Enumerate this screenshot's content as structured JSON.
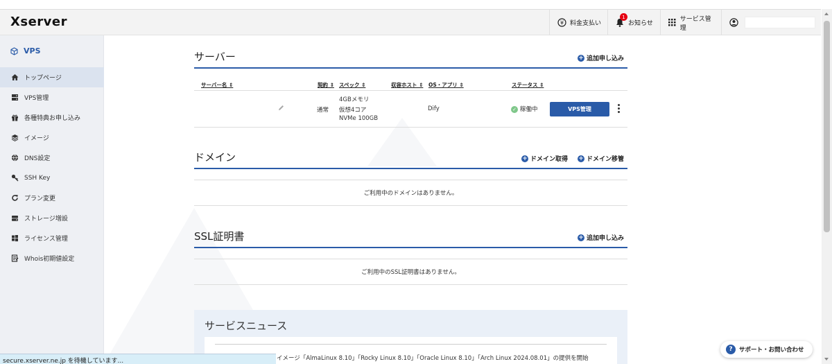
{
  "header": {
    "logo": "Xserver",
    "payment": "料金支払い",
    "notifications": "お知らせ",
    "notification_count": "1",
    "services": "サービス管理",
    "account_value": ""
  },
  "sidebar": {
    "title": "VPS",
    "items": [
      {
        "label": "トップページ",
        "icon": "home-icon"
      },
      {
        "label": "VPS管理",
        "icon": "server-icon"
      },
      {
        "label": "各種特典お申し込み",
        "icon": "gift-icon"
      },
      {
        "label": "イメージ",
        "icon": "layers-icon"
      },
      {
        "label": "DNS設定",
        "icon": "globe-icon"
      },
      {
        "label": "SSH Key",
        "icon": "key-icon"
      },
      {
        "label": "プラン変更",
        "icon": "refresh-icon"
      },
      {
        "label": "ストレージ増設",
        "icon": "storage-icon"
      },
      {
        "label": "ライセンス管理",
        "icon": "windows-icon"
      },
      {
        "label": "Whois初期値設定",
        "icon": "document-icon"
      }
    ]
  },
  "server_section": {
    "title": "サーバー",
    "add_label": "追加申し込み",
    "columns": {
      "name": "サーバー名 ⇕",
      "contract": "契約 ⇕",
      "spec": "スペック ⇕",
      "host": "収容ホスト ⇕",
      "os": "OS・アプリ ⇕",
      "status": "ステータス ⇕"
    },
    "row": {
      "name": "",
      "contract": "通常",
      "spec_line1": "4GBメモリ",
      "spec_line2": "仮想4コア",
      "spec_line3": "NVMe 100GB",
      "host": "",
      "os": "Dify",
      "status": "稼働中",
      "manage_button": "VPS管理"
    }
  },
  "domain_section": {
    "title": "ドメイン",
    "acquire_label": "ドメイン取得",
    "transfer_label": "ドメイン移管",
    "empty": "ご利用中のドメインはありません。"
  },
  "ssl_section": {
    "title": "SSL証明書",
    "add_label": "追加申し込み",
    "empty": "ご利用中のSSL証明書はありません。"
  },
  "news": {
    "title": "サービスニュース",
    "text": "イメージ「AlmaLinux 8.10」「Rocky Linux 8.10」「Oracle Linux 8.10」「Arch Linux 2024.08.01」の提供を開始"
  },
  "support_button": "サポート・お問い合わせ",
  "status_bar": "secure.xserver.ne.jp を待機しています...",
  "colors": {
    "accent": "#2a5ba8",
    "status_ok": "#7fc78a",
    "badge": "#e60012"
  }
}
